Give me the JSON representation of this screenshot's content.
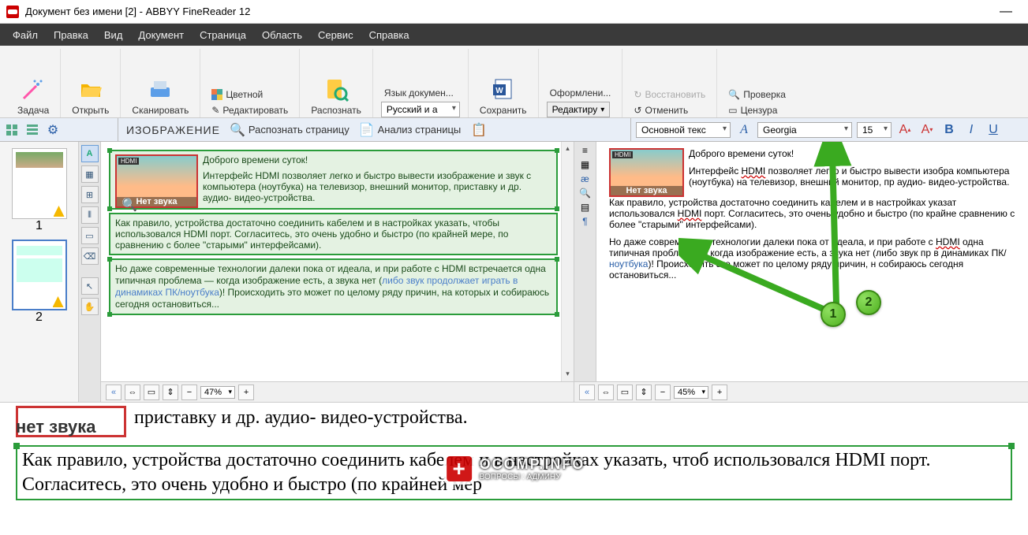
{
  "window": {
    "title": "Документ без имени [2] - ABBYY FineReader 12"
  },
  "menu": {
    "file": "Файл",
    "edit": "Правка",
    "view": "Вид",
    "document": "Документ",
    "page": "Страница",
    "area": "Область",
    "service": "Сервис",
    "help": "Справка"
  },
  "ribbon": {
    "task": "Задача",
    "open": "Открыть",
    "scan": "Сканировать",
    "color": "Цветной",
    "editimg": "Редактировать",
    "recognize": "Распознать",
    "doclang_label": "Язык докумен...",
    "doclang_value": "Русский и а",
    "save": "Сохранить",
    "layout_label": "Оформлени...",
    "layout_value": "Редактиру",
    "restore": "Восстановить",
    "undo": "Отменить",
    "check": "Проверка",
    "censor": "Цензура"
  },
  "subbar": {
    "image_title": "ИЗОБРАЖЕНИЕ",
    "recognize_page": "Распознать страницу",
    "analyze_page": "Анализ страницы",
    "style_value": "Основной текс",
    "font_value": "Georgia",
    "size_value": "15"
  },
  "thumbs": {
    "p1": "1",
    "p2": "2"
  },
  "doc": {
    "greeting": "Доброго времени суток!",
    "p1": "Интерфейс HDMI позволяет легко и быстро вывести изображение и звук с компьютера (ноутбука) на телевизор, внешний монитор, приставку и др. аудио- видео-устройства.",
    "p2": "Как правило, устройства достаточно соединить кабелем и в настройках указать, чтобы использовался HDMI порт. Согласитесь, это очень удобно и быстро (по крайней мере, по сравнению с более \"старыми\" интерфейсами).",
    "p3a": "Но даже современные технологии далеки пока от идеала, и при работе с HDMI встречается одна типичная проблема — когда изображение есть, а звука нет (",
    "p3link": "либо звук продолжает играть в динамиках ПК/ноутбука",
    "p3b": ")! Происходить это может по целому ряду причин, на которых и собираюсь сегодня остановиться...",
    "hdmi_label": "HDMI",
    "hdmi_caption": "Нет звука"
  },
  "txt": {
    "greeting": "Доброго времени суток!",
    "p1a": "Интерфейс ",
    "p1h": "HDMI",
    "p1b": " позволяет легко и быстро вывести изобра компьютера (ноутбука) на телевизор, внешний монитор, пр аудио- видео-устройства.",
    "p2a": "Как правило, устройства достаточно соединить кабелем и в настройках указат использовался ",
    "p2h": "HDMI",
    "p2b": " порт. Согласитесь, это очень удобно и быстро (по крайне сравнению с более \"старыми\" интерфейсами).",
    "p3a": "Но даже современные технологии далеки пока от идеала, и при работе с ",
    "p3h": "HDMI",
    "p3b": " одна типичная проблема — когда изображение есть, а звука нет (либо звук пр в динамиках ПК/",
    "p3n": "ноутбука",
    "p3c": ")! Происходить это может по целому ряду причин, н собираюсь сегодня остановиться..."
  },
  "zoom": {
    "left_value": "47%",
    "right_value": "45%"
  },
  "bigview": {
    "hdmi_caption": "нет звука",
    "line1": "приставку и др. аудио- видео-устройства.",
    "line2": "Как правило, устройства достаточно соединить кабелем и в настройках указать, чтоб использовался HDMI порт. Согласитесь, это очень удобно и быстро (по крайней мер"
  },
  "watermark": {
    "line1": "OCOMP.INFO",
    "line2": "ВОПРОСЫ : АДМИНУ"
  },
  "callouts": {
    "c1": "1",
    "c2": "2"
  }
}
